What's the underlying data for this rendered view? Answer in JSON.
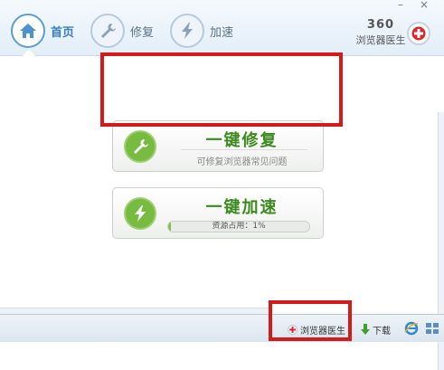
{
  "window": {
    "minimize": "–",
    "close": "×"
  },
  "tabs": [
    {
      "label": "首页",
      "icon": "home-icon"
    },
    {
      "label": "修复",
      "icon": "wrench-icon"
    },
    {
      "label": "加速",
      "icon": "lightning-icon"
    }
  ],
  "brand": {
    "number": "360",
    "name": "浏览器医生"
  },
  "cards": {
    "repair": {
      "title": "一键修复",
      "subtitle": "可修复浏览器常见问题",
      "icon": "wrench-icon"
    },
    "speed": {
      "title": "一键加速",
      "progress_text": "资源占用：1%",
      "progress_value": 0.01,
      "icon": "lightning-icon"
    }
  },
  "statusbar": {
    "doctor_label": "浏览器医生",
    "download_label": "下载"
  },
  "colors": {
    "accent_green": "#77bb41",
    "highlight_red": "#d41a1a",
    "tab_blue": "#3a7fbd"
  }
}
